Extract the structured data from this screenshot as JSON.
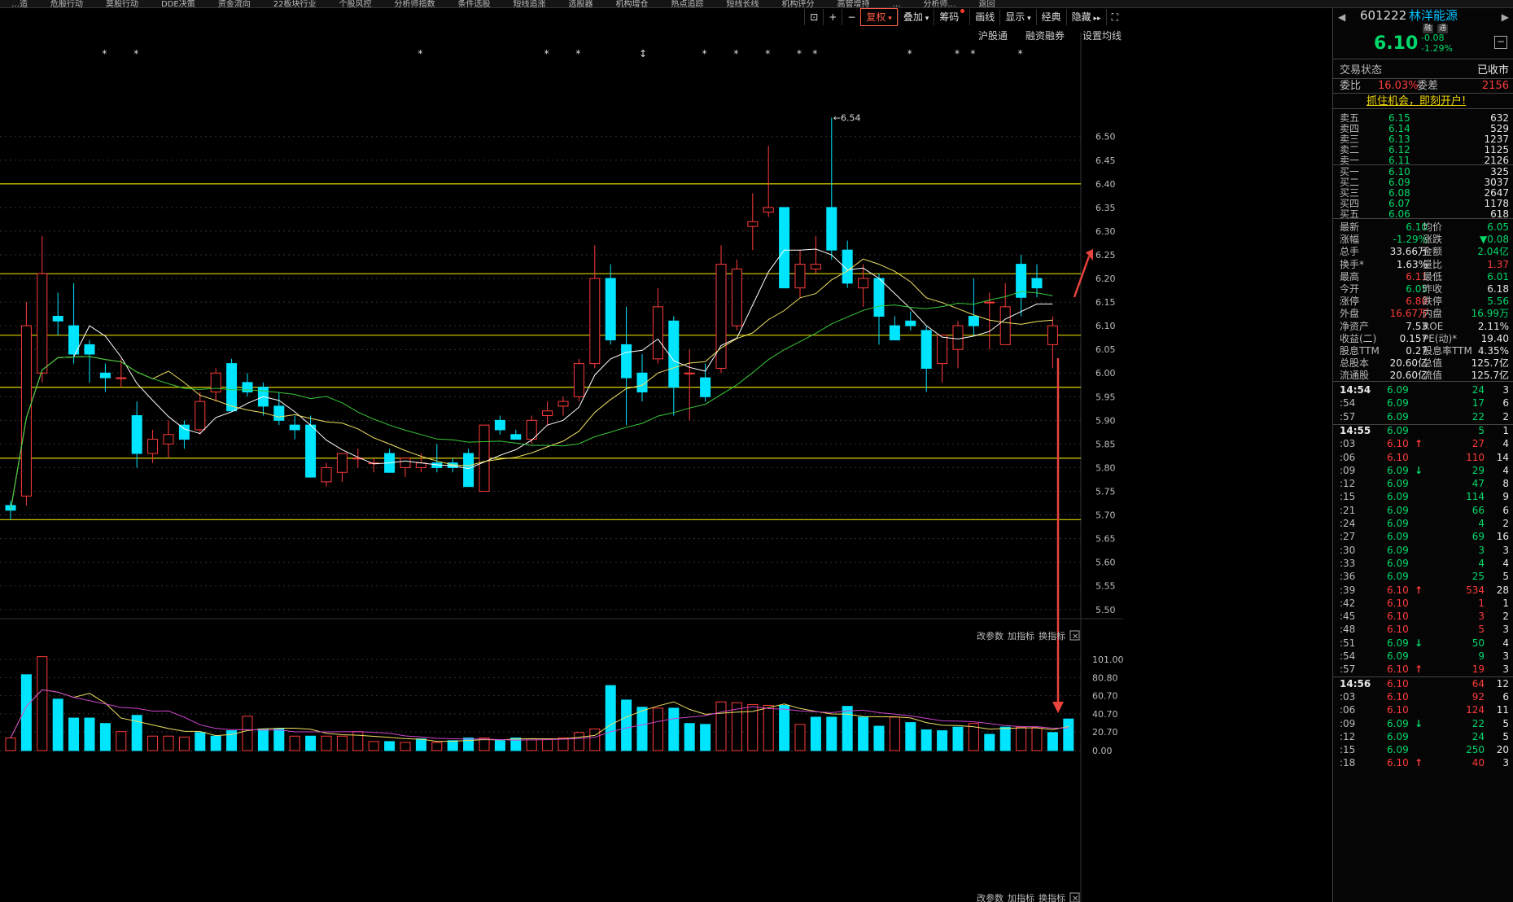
{
  "topbar": {
    "items": [
      "…造",
      "危股行动",
      "莫股行动",
      "DDE决策",
      "资金流向",
      "22板块行业",
      "个股风控",
      "分析师指数",
      "条件选股",
      "短线追涨",
      "选股器",
      "机构增仓",
      "热点追踪",
      "短线长线",
      "机构评分",
      "高管增持",
      "…",
      "分析师…",
      "返回"
    ]
  },
  "toolbar": {
    "items": [
      "复权",
      "叠加",
      "筹码",
      "画线",
      "显示",
      "经典",
      "隐藏"
    ],
    "active": "复权"
  },
  "subbar": {
    "items": [
      "沪股通",
      "融资融券",
      "设置均线"
    ]
  },
  "colors": {
    "up": "#ff3b3b",
    "down": "#00e5ff",
    "ma5": "#ffffff",
    "ma10": "#f0e060",
    "ma20": "#38c838",
    "vol_ma1": "#f0e060",
    "vol_ma2": "#cc44cc",
    "level_line": "#c8c000",
    "arrow": "#e8443c",
    "grid": "#333333"
  },
  "chart_data": [
    {
      "type": "candlestick",
      "ylim": [
        5.46,
        6.62
      ],
      "y_ticks": [
        "6.50",
        "6.45",
        "6.40",
        "6.35",
        "6.30",
        "6.25",
        "6.20",
        "6.15",
        "6.10",
        "6.05",
        "6.00",
        "5.95",
        "5.90",
        "5.85",
        "5.80",
        "5.75",
        "5.70",
        "5.65",
        "5.60",
        "5.55",
        "5.50"
      ],
      "max_label": "6.54",
      "level_lines": [
        6.4,
        6.21,
        6.08,
        5.97,
        5.82,
        5.69
      ],
      "ohlc": [
        [
          5.72,
          5.73,
          5.69,
          5.71
        ],
        [
          5.74,
          6.15,
          5.72,
          6.1
        ],
        [
          6.0,
          6.29,
          5.98,
          6.21
        ],
        [
          6.12,
          6.17,
          6.08,
          6.11
        ],
        [
          6.1,
          6.19,
          6.02,
          6.04
        ],
        [
          6.06,
          6.07,
          5.98,
          6.04
        ],
        [
          6.0,
          6.02,
          5.96,
          5.99
        ],
        [
          5.99,
          6.03,
          5.97,
          5.99
        ],
        [
          5.91,
          5.94,
          5.8,
          5.83
        ],
        [
          5.83,
          5.88,
          5.81,
          5.86
        ],
        [
          5.85,
          5.9,
          5.82,
          5.87
        ],
        [
          5.89,
          5.9,
          5.84,
          5.86
        ],
        [
          5.88,
          5.96,
          5.87,
          5.94
        ],
        [
          5.96,
          6.01,
          5.94,
          6.0
        ],
        [
          6.02,
          6.03,
          5.92,
          5.92
        ],
        [
          5.98,
          6.0,
          5.95,
          5.96
        ],
        [
          5.97,
          5.98,
          5.91,
          5.93
        ],
        [
          5.93,
          5.96,
          5.89,
          5.9
        ],
        [
          5.89,
          5.91,
          5.86,
          5.88
        ],
        [
          5.89,
          5.91,
          5.78,
          5.78
        ],
        [
          5.77,
          5.81,
          5.76,
          5.8
        ],
        [
          5.79,
          5.83,
          5.77,
          5.83
        ],
        [
          5.82,
          5.84,
          5.8,
          5.82
        ],
        [
          5.81,
          5.82,
          5.79,
          5.81
        ],
        [
          5.83,
          5.84,
          5.79,
          5.79
        ],
        [
          5.8,
          5.82,
          5.78,
          5.82
        ],
        [
          5.8,
          5.83,
          5.79,
          5.81
        ],
        [
          5.81,
          5.85,
          5.79,
          5.8
        ],
        [
          5.81,
          5.82,
          5.79,
          5.8
        ],
        [
          5.83,
          5.84,
          5.76,
          5.76
        ],
        [
          5.75,
          5.89,
          5.75,
          5.89
        ],
        [
          5.9,
          5.91,
          5.87,
          5.88
        ],
        [
          5.87,
          5.88,
          5.86,
          5.86
        ],
        [
          5.86,
          5.91,
          5.85,
          5.9
        ],
        [
          5.91,
          5.94,
          5.89,
          5.92
        ],
        [
          5.93,
          5.95,
          5.91,
          5.94
        ],
        [
          5.95,
          6.03,
          5.94,
          6.02
        ],
        [
          6.02,
          6.27,
          6.01,
          6.2
        ],
        [
          6.2,
          6.23,
          6.06,
          6.07
        ],
        [
          6.06,
          6.14,
          5.89,
          5.99
        ],
        [
          6.0,
          6.04,
          5.94,
          5.96
        ],
        [
          6.03,
          6.18,
          6.02,
          6.14
        ],
        [
          6.11,
          6.12,
          5.91,
          5.97
        ],
        [
          6.0,
          6.05,
          5.9,
          6.0
        ],
        [
          5.99,
          6.02,
          5.94,
          5.95
        ],
        [
          6.01,
          6.27,
          6.0,
          6.23
        ],
        [
          6.1,
          6.24,
          6.09,
          6.22
        ],
        [
          6.31,
          6.38,
          6.26,
          6.32
        ],
        [
          6.34,
          6.48,
          6.33,
          6.35
        ],
        [
          6.35,
          6.31,
          6.18,
          6.18
        ],
        [
          6.18,
          6.26,
          6.16,
          6.23
        ],
        [
          6.22,
          6.29,
          6.21,
          6.23
        ],
        [
          6.35,
          6.54,
          6.24,
          6.26
        ],
        [
          6.26,
          6.28,
          6.18,
          6.19
        ],
        [
          6.18,
          6.23,
          6.14,
          6.2
        ],
        [
          6.2,
          6.21,
          6.06,
          6.12
        ],
        [
          6.1,
          6.12,
          6.07,
          6.07
        ],
        [
          6.11,
          6.13,
          6.09,
          6.1
        ],
        [
          6.09,
          6.1,
          5.96,
          6.01
        ],
        [
          6.02,
          6.08,
          5.98,
          6.08
        ],
        [
          6.05,
          6.11,
          6.01,
          6.1
        ],
        [
          6.12,
          6.2,
          6.08,
          6.1
        ],
        [
          6.15,
          6.17,
          6.05,
          6.15
        ],
        [
          6.06,
          6.19,
          6.06,
          6.14
        ],
        [
          6.23,
          6.25,
          6.12,
          6.16
        ],
        [
          6.2,
          6.23,
          6.16,
          6.18
        ],
        [
          6.06,
          6.12,
          6.01,
          6.1
        ]
      ]
    },
    {
      "type": "bar",
      "ylim": [
        0,
        110
      ],
      "y_ticks": [
        "101.00",
        "80.80",
        "60.70",
        "40.70",
        "20.70",
        "0.00"
      ],
      "values": [
        14,
        84,
        104,
        57,
        36,
        36,
        30,
        21,
        39,
        16,
        16,
        15,
        20,
        16,
        22,
        38,
        24,
        24,
        16,
        16,
        16,
        16,
        21,
        10,
        10,
        9,
        13,
        9,
        11,
        14,
        14,
        11,
        14,
        13,
        13,
        14,
        20,
        24,
        72,
        56,
        48,
        47,
        47,
        30,
        29,
        54,
        53,
        51,
        50,
        50,
        29,
        37,
        37,
        49,
        37,
        27,
        37,
        31,
        23,
        22,
        26,
        30,
        18,
        26,
        26,
        26,
        20,
        35
      ],
      "colors_up": [
        1,
        0,
        1,
        0,
        0,
        0,
        0,
        1,
        0,
        1,
        1,
        1,
        0,
        0,
        0,
        1,
        0,
        0,
        1,
        0,
        1,
        1,
        1,
        1,
        0,
        1,
        0,
        1,
        0,
        0,
        1,
        0,
        0,
        1,
        1,
        1,
        1,
        1,
        0,
        0,
        0,
        1,
        0,
        0,
        0,
        1,
        1,
        1,
        1,
        0,
        1,
        0,
        0,
        0,
        0,
        0,
        1,
        0,
        0,
        0,
        0,
        1,
        0,
        0,
        1,
        1,
        0,
        0
      ]
    }
  ],
  "volume_subbar": {
    "items": [
      "改参数",
      "加指标",
      "换指标"
    ]
  },
  "bottom_subbar": {
    "items": [
      "改参数",
      "加指标",
      "换指标"
    ]
  },
  "stars_label": "*",
  "quote": {
    "code": "601222",
    "name": "林洋能源",
    "tags": [
      "融",
      "通"
    ],
    "price": "6.10",
    "change": "-0.08",
    "change_pct": "-1.29%",
    "status_label": "交易状态",
    "status_value": "已收市",
    "weibi_label": "委比",
    "weibi_value": "16.03%",
    "weicha_label": "委差",
    "weicha_value": "2156",
    "promo": "抓住机会，即刻开户!",
    "sell": [
      [
        "卖五",
        "6.15",
        "632"
      ],
      [
        "卖四",
        "6.14",
        "529"
      ],
      [
        "卖三",
        "6.13",
        "1237"
      ],
      [
        "卖二",
        "6.12",
        "1125"
      ],
      [
        "卖一",
        "6.11",
        "2126"
      ]
    ],
    "buy": [
      [
        "买一",
        "6.10",
        "325"
      ],
      [
        "买二",
        "6.09",
        "3037"
      ],
      [
        "买三",
        "6.08",
        "2647"
      ],
      [
        "买四",
        "6.07",
        "1178"
      ],
      [
        "买五",
        "6.06",
        "618"
      ]
    ],
    "stats": [
      [
        "最新",
        "6.10",
        "均价",
        "6.05"
      ],
      [
        "涨幅",
        "-1.29%",
        "涨跌",
        "▼0.08"
      ],
      [
        "总手",
        "33.66万",
        "金额",
        "2.04亿"
      ],
      [
        "换手*",
        "1.63%",
        "量比",
        "1.37"
      ],
      [
        "最高",
        "6.11",
        "最低",
        "6.01"
      ],
      [
        "今开",
        "6.05",
        "昨收",
        "6.18"
      ],
      [
        "涨停",
        "6.80",
        "跌停",
        "5.56"
      ],
      [
        "外盘",
        "16.67万",
        "内盘",
        "16.99万"
      ],
      [
        "净资产",
        "7.53",
        "ROE",
        "2.11%"
      ],
      [
        "收益(二)",
        "0.157",
        "PE(动)*",
        "19.40"
      ],
      [
        "股息TTM",
        "0.27",
        "股息率TTM",
        "4.35%"
      ],
      [
        "总股本",
        "20.60亿",
        "总值",
        "125.7亿"
      ],
      [
        "流通股",
        "20.60亿",
        "流值",
        "125.7亿"
      ]
    ],
    "ticks": [
      [
        "14:54",
        "6.09",
        "",
        "24",
        "3"
      ],
      [
        ":54",
        "6.09",
        "",
        "17",
        "6"
      ],
      [
        ":57",
        "6.09",
        "",
        "22",
        "2"
      ],
      [
        "14:55",
        "6.09",
        "",
        "5",
        "1"
      ],
      [
        ":03",
        "6.10",
        "up",
        "27",
        "4"
      ],
      [
        ":06",
        "6.10",
        "",
        "110",
        "14"
      ],
      [
        ":09",
        "6.09",
        "down",
        "29",
        "4"
      ],
      [
        ":12",
        "6.09",
        "",
        "47",
        "8"
      ],
      [
        ":15",
        "6.09",
        "",
        "114",
        "9"
      ],
      [
        ":21",
        "6.09",
        "",
        "66",
        "6"
      ],
      [
        ":24",
        "6.09",
        "",
        "4",
        "2"
      ],
      [
        ":27",
        "6.09",
        "",
        "69",
        "16"
      ],
      [
        ":30",
        "6.09",
        "",
        "3",
        "3"
      ],
      [
        ":33",
        "6.09",
        "",
        "4",
        "4"
      ],
      [
        ":36",
        "6.09",
        "",
        "25",
        "5"
      ],
      [
        ":39",
        "6.10",
        "up",
        "534",
        "28"
      ],
      [
        ":42",
        "6.10",
        "",
        "1",
        "1"
      ],
      [
        ":45",
        "6.10",
        "",
        "3",
        "2"
      ],
      [
        ":48",
        "6.10",
        "",
        "5",
        "3"
      ],
      [
        ":51",
        "6.09",
        "down",
        "50",
        "4"
      ],
      [
        ":54",
        "6.09",
        "",
        "9",
        "3"
      ],
      [
        ":57",
        "6.10",
        "up",
        "19",
        "3"
      ],
      [
        "14:56",
        "6.10",
        "",
        "64",
        "12"
      ],
      [
        ":03",
        "6.10",
        "",
        "92",
        "6"
      ],
      [
        ":06",
        "6.10",
        "",
        "124",
        "11"
      ],
      [
        ":09",
        "6.09",
        "down",
        "22",
        "5"
      ],
      [
        ":12",
        "6.09",
        "",
        "24",
        "5"
      ],
      [
        ":15",
        "6.09",
        "",
        "250",
        "20"
      ],
      [
        ":18",
        "6.10",
        "up",
        "40",
        "3"
      ]
    ]
  }
}
